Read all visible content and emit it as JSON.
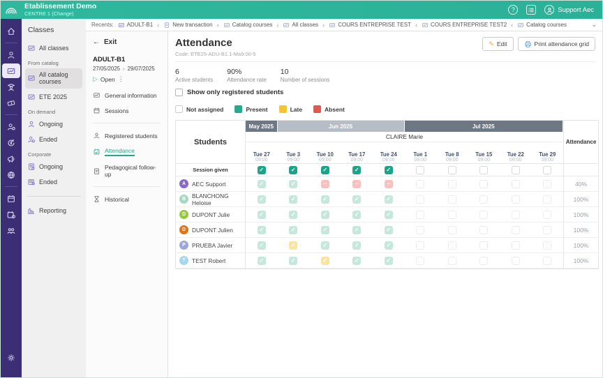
{
  "topbar": {
    "org": "Etablissement Demo",
    "center": "CENTRE 1",
    "change": "(Change)",
    "help_icon": "question-circle",
    "forms_icon": "checklist",
    "user_icon": "person-circle",
    "user": "Support Aec"
  },
  "rail": {
    "icons": [
      "home-icon",
      "contacts-icon",
      "classes-icon",
      "trainers-icon",
      "voucher-icon",
      "student-badge-icon",
      "refund-icon",
      "marketing-icon",
      "web-portal-icon",
      "calendar-icon",
      "planning-icon",
      "meetings-icon",
      "settings-icon"
    ],
    "selected": "classes-icon"
  },
  "nav": {
    "title": "Classes",
    "all_classes": "All classes",
    "from_catalog": "From catalog",
    "all_catalog_courses": "All catalog courses",
    "ete_2025": "ETE 2025",
    "on_demand": "On demand",
    "ongoing_demand": "Ongoing",
    "ended_demand": "Ended",
    "corporate": "Corporate",
    "ongoing_corporate": "Ongoing",
    "ended_corporate": "Ended",
    "reporting": "Reporting"
  },
  "recents": {
    "label": "Recents:",
    "items": [
      {
        "label": "ADULT-B1",
        "icon": "class-icon"
      },
      {
        "label": "New transaction",
        "icon": "document-icon"
      },
      {
        "label": "Catalog courses",
        "icon": "class-icon"
      },
      {
        "label": "All classes",
        "icon": "class-icon"
      },
      {
        "label": "COURS ENTREPRISE TEST",
        "icon": "class-icon"
      },
      {
        "label": "COURS ENTREPRISE TEST2",
        "icon": "class-icon"
      },
      {
        "label": "Catalog courses",
        "icon": "class-icon"
      }
    ]
  },
  "detail": {
    "exit": "Exit",
    "class_name": "ADULT-B1",
    "date_start": "27/05/2025",
    "date_end": "29/07/2025",
    "status": "Open",
    "menu_general": "General information",
    "menu_sessions": "Sessions",
    "menu_registered": "Registered students",
    "menu_attendance": "Attendance",
    "menu_pedagogical": "Pedagogical follow-up",
    "menu_historical": "Historical"
  },
  "main": {
    "title": "Attendance",
    "code": "Code: ETE25-ADU-B1.1-Ma9:00-5",
    "edit_label": "Edit",
    "print_label": "Print attendance grid",
    "stats": [
      {
        "value": "6",
        "label": "Active students"
      },
      {
        "value": "90%",
        "label": "Attendance rate"
      },
      {
        "value": "10",
        "label": "Number of sessions"
      }
    ],
    "filter_label": "Show only registered students",
    "legend": [
      {
        "label": "Not assigned",
        "color": "#ffffff"
      },
      {
        "label": "Present",
        "color": "#27a98e"
      },
      {
        "label": "Late",
        "color": "#f4c433"
      },
      {
        "label": "Absent",
        "color": "#e4574f"
      }
    ]
  },
  "table": {
    "students_header": "Students",
    "attendance_header": "Attendance",
    "teacher": "CLAIRE Marie",
    "months": [
      {
        "label": "May 2025",
        "span": 1,
        "shade": "dark"
      },
      {
        "label": "Jun 2025",
        "span": 4,
        "shade": "light"
      },
      {
        "label": "Jul 2025",
        "span": 5,
        "shade": "dark"
      }
    ],
    "dates": [
      {
        "day": "Tue 27",
        "time": "09:00"
      },
      {
        "day": "Tue 3",
        "time": "09:00"
      },
      {
        "day": "Tue 10",
        "time": "09:00"
      },
      {
        "day": "Tue 17",
        "time": "09:00"
      },
      {
        "day": "Tue 24",
        "time": "09:00"
      },
      {
        "day": "Tue 1",
        "time": "09:00"
      },
      {
        "day": "Tue 8",
        "time": "09:00"
      },
      {
        "day": "Tue 15",
        "time": "09:00"
      },
      {
        "day": "Tue 22",
        "time": "09:00"
      },
      {
        "day": "Tue 29",
        "time": "09:00"
      }
    ],
    "session_given_label": "Session given",
    "session_given": [
      "given",
      "given",
      "given",
      "given",
      "given",
      "unchecked",
      "unchecked",
      "unchecked",
      "unchecked",
      "unchecked"
    ],
    "rows": [
      {
        "initial": "A",
        "color": "#8a68c8",
        "name": "AEC Support",
        "marks": [
          "present",
          "present",
          "absent",
          "absent",
          "absent",
          "none",
          "none",
          "none",
          "none",
          "none"
        ],
        "attendance": "40%"
      },
      {
        "initial": "B",
        "color": "#a5d9c3",
        "name": "BLANCHONG Heloise",
        "marks": [
          "present",
          "present",
          "present",
          "present",
          "present",
          "none",
          "none",
          "none",
          "none",
          "none"
        ],
        "attendance": "100%"
      },
      {
        "initial": "D",
        "color": "#97c93d",
        "name": "DUPONT Julie",
        "marks": [
          "present",
          "present",
          "present",
          "present",
          "present",
          "none",
          "none",
          "none",
          "none",
          "none"
        ],
        "attendance": "100%"
      },
      {
        "initial": "D",
        "color": "#e8720f",
        "name": "DUPONT Julien",
        "marks": [
          "present",
          "present",
          "present",
          "present",
          "present",
          "none",
          "none",
          "none",
          "none",
          "none"
        ],
        "attendance": "100%"
      },
      {
        "initial": "P",
        "color": "#9aa6dc",
        "name": "PRUEBA Javier",
        "marks": [
          "present",
          "late",
          "present",
          "present",
          "present",
          "none",
          "none",
          "none",
          "none",
          "none"
        ],
        "attendance": "100%"
      },
      {
        "initial": "T",
        "color": "#a7d7f0",
        "name": "TEST Robert",
        "marks": [
          "present",
          "present",
          "late",
          "present",
          "present",
          "none",
          "none",
          "none",
          "none",
          "none"
        ],
        "attendance": "100%"
      }
    ]
  }
}
